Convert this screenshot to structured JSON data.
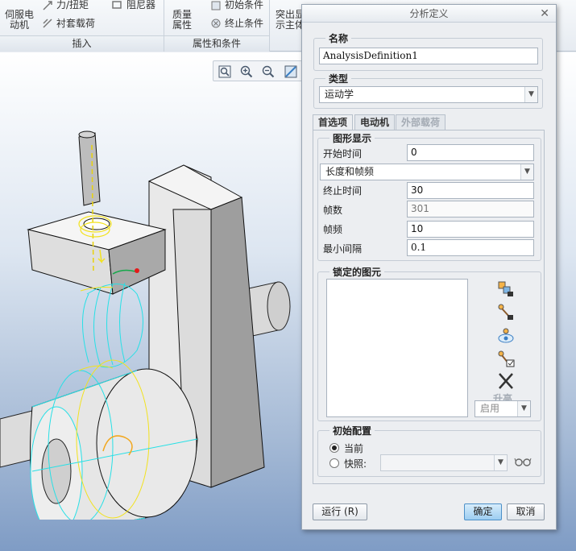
{
  "ribbon": {
    "servo_motor": "伺服电\n动机",
    "force_torque": "力/扭矩",
    "damper": "阻尼器",
    "lining_load": "衬套载荷",
    "mass_props": "质量\n属性",
    "initial_cond": "初始条件",
    "terminate_cond": "终止条件",
    "highlight": "突出显\n示主体",
    "group_insert": "插入",
    "group_props": "属性和条件"
  },
  "viewport_tools": [
    "zoom-fit-icon",
    "zoom-in-icon",
    "zoom-out-icon",
    "repaint-icon"
  ],
  "dialog": {
    "title": "分析定义",
    "name_label": "名称",
    "name_value": "AnalysisDefinition1",
    "type_label": "类型",
    "type_value": "运动学",
    "tabs": [
      "首选项",
      "电动机",
      "外部载荷"
    ],
    "graph_display_label": "图形显示",
    "start_time_label": "开始时间",
    "start_time_value": "0",
    "mode_value": "长度和帧频",
    "end_time_label": "终止时间",
    "end_time_value": "30",
    "frames_label": "帧数",
    "frames_value": "301",
    "frame_rate_label": "帧频",
    "frame_rate_value": "10",
    "min_interval_label": "最小间隔",
    "min_interval_value": "0.1",
    "locked_label": "锁定的图元",
    "lift_label": "升高",
    "enable_value": "启用",
    "init_config_label": "初始配置",
    "current_label": "当前",
    "snapshot_label": "快照:",
    "run_button": "运行 (R)",
    "ok_button": "确定",
    "cancel_button": "取消"
  },
  "colors": {
    "accent_cyan": "#27e0e6",
    "accent_yellow": "#f2e21d",
    "viewport_bottom": "#7f9cc5"
  }
}
